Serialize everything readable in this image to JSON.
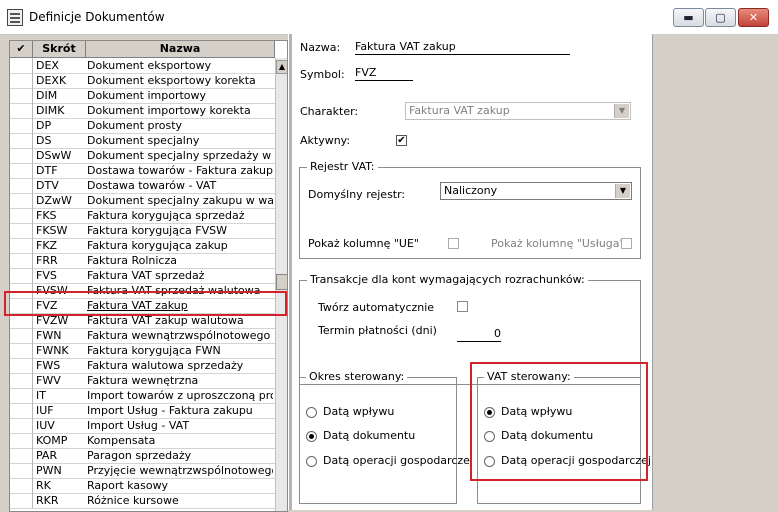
{
  "window": {
    "title": "Definicje Dokumentów",
    "minimize": "▬",
    "maximize": "▢",
    "close": "✕"
  },
  "list": {
    "header": {
      "check": "✔",
      "code": "Skrót",
      "name": "Nazwa"
    },
    "rows": [
      {
        "code": "DEX",
        "name": "Dokument eksportowy"
      },
      {
        "code": "DEXK",
        "name": "Dokument eksportowy korekta"
      },
      {
        "code": "DIM",
        "name": "Dokument importowy"
      },
      {
        "code": "DIMK",
        "name": "Dokument importowy korekta"
      },
      {
        "code": "DP",
        "name": "Dokument prosty"
      },
      {
        "code": "DS",
        "name": "Dokument specjalny"
      },
      {
        "code": "DSwW",
        "name": "Dokument specjalny sprzedaży w wal"
      },
      {
        "code": "DTF",
        "name": "Dostawa towarów - Faktura zakupu"
      },
      {
        "code": "DTV",
        "name": "Dostawa towarów - VAT"
      },
      {
        "code": "DZwW",
        "name": "Dokument specjalny zakupu w waluci"
      },
      {
        "code": "FKS",
        "name": "Faktura korygująca sprzedaż"
      },
      {
        "code": "FKSW",
        "name": "Faktura korygująca FVSW"
      },
      {
        "code": "FKZ",
        "name": "Faktura korygująca zakup"
      },
      {
        "code": "FRR",
        "name": "Faktura Rolnicza"
      },
      {
        "code": "FVS",
        "name": "Faktura VAT sprzedaż"
      },
      {
        "code": "FVSW",
        "name": "Faktura VAT sprzedaż walutowa"
      },
      {
        "code": "FVZ",
        "name": "Faktura VAT zakup"
      },
      {
        "code": "FVZW",
        "name": "Faktura VAT zakup walutowa"
      },
      {
        "code": "FWN",
        "name": "Faktura wewnątrzwspólnotowego na"
      },
      {
        "code": "FWNK",
        "name": "Faktura korygująca FWN"
      },
      {
        "code": "FWS",
        "name": "Faktura walutowa sprzedaży"
      },
      {
        "code": "FWV",
        "name": "Faktura wewnętrzna"
      },
      {
        "code": "IT",
        "name": "Import towarów z uproszczoną proce"
      },
      {
        "code": "IUF",
        "name": "Import Usług - Faktura zakupu"
      },
      {
        "code": "IUV",
        "name": "Import Usług - VAT"
      },
      {
        "code": "KOMP",
        "name": "Kompensata"
      },
      {
        "code": "PAR",
        "name": "Paragon sprzedaży"
      },
      {
        "code": "PWN",
        "name": "Przyjęcie wewnątrzwspólnotowego n"
      },
      {
        "code": "RK",
        "name": "Raport kasowy"
      },
      {
        "code": "RKR",
        "name": "Różnice kursowe"
      }
    ]
  },
  "form": {
    "nazwa_label": "Nazwa:",
    "nazwa_value": "Faktura VAT zakup",
    "symbol_label": "Symbol:",
    "symbol_value": "FVZ",
    "charakter_label": "Charakter:",
    "charakter_value": "Faktura VAT zakup",
    "aktywny_label": "Aktywny:",
    "aktywny_check": "✔",
    "rejestr": {
      "legend": "Rejestr VAT:",
      "domyslny_label": "Domyślny rejestr:",
      "domyslny_value": "Naliczony",
      "ue_label": "Pokaż kolumnę \"UE\"",
      "usluga_label": "Pokaż kolumnę \"Usługa\""
    },
    "transakcje": {
      "legend": "Transakcje dla kont wymagających rozrachunków:",
      "auto_label": "Twórz automatycznie",
      "termin_label": "Termin płatności (dni)",
      "termin_value": "0"
    },
    "okres": {
      "legend": "Okres sterowany:",
      "options": [
        "Datą wpływu",
        "Datą dokumentu",
        "Datą operacji gospodarczej"
      ],
      "selected": 1
    },
    "vat": {
      "legend": "VAT sterowany:",
      "options": [
        "Datą wpływu",
        "Datą dokumentu",
        "Datą operacji gospodarczej"
      ],
      "selected": 0
    }
  },
  "colors": {
    "highlight_border": "#d2232a"
  }
}
